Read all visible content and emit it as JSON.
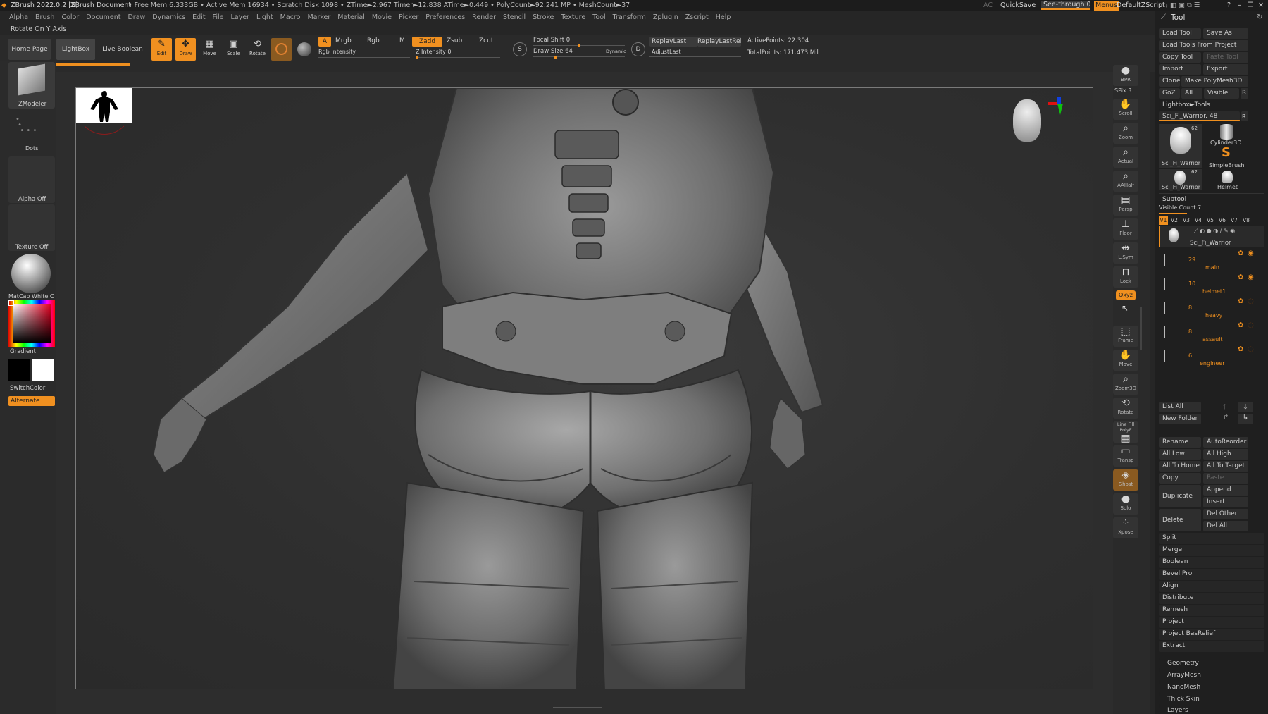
{
  "titlebar": {
    "app": "ZBrush 2022.0.2 [S]",
    "doc": "ZBrush Document",
    "stats": "• Free Mem 6.333GB • Active Mem 16934 • Scratch Disk 1098 • ZTime►2.967 Timer►12.838 ATime►0.449 • PolyCount►92.241 MP • MeshCount►37",
    "ac": "AC",
    "quicksave": "QuickSave",
    "seethrough": "See-through",
    "seethrough_value": "0",
    "menus": "Menus",
    "zscript": "DefaultZScript"
  },
  "menubar": [
    "Alpha",
    "Brush",
    "Color",
    "Document",
    "Draw",
    "Dynamics",
    "Edit",
    "File",
    "Layer",
    "Light",
    "Macro",
    "Marker",
    "Material",
    "Movie",
    "Picker",
    "Preferences",
    "Render",
    "Stencil",
    "Stroke",
    "Texture",
    "Tool",
    "Transform",
    "Zplugin",
    "Zscript",
    "Help"
  ],
  "status_hint": "Rotate On Y Axis",
  "shelf": {
    "home": "Home Page",
    "lightbox": "LightBox",
    "live_boolean": "Live Boolean",
    "edit": "Edit",
    "draw": "Draw",
    "move": "Move",
    "scale": "Scale",
    "rotate": "Rotate",
    "a": "A",
    "mrgb": "Mrgb",
    "rgb": "Rgb",
    "m": "M",
    "rgb_intensity": "Rgb Intensity",
    "zadd": "Zadd",
    "zsub": "Zsub",
    "zcut": "Zcut",
    "z_intensity": "Z Intensity",
    "z_intensity_value": "0",
    "focal_shift": "Focal Shift",
    "focal_shift_value": "0",
    "draw_size": "Draw Size",
    "draw_size_value": "64",
    "dynamic": "Dynamic",
    "replay_last": "ReplayLast",
    "replay_last_rel": "ReplayLastRel",
    "adjust_last": "AdjustLast",
    "active_points": "ActivePoints: 22.304",
    "total_points": "TotalPoints: 171.473 Mil"
  },
  "left": {
    "zmodeler": "ZModeler",
    "dots": "Dots",
    "alpha_off": "Alpha Off",
    "texture_off": "Texture Off",
    "matcap": "MatCap White C",
    "gradient": "Gradient",
    "switchcolor": "SwitchColor",
    "alternate": "Alternate"
  },
  "rightstrip": [
    "BPR",
    "SPix",
    "Scroll",
    "Zoom",
    "Actual",
    "AAHalf",
    "Persp",
    "Floor",
    "L.Sym",
    "Lock",
    "Qxyz",
    "",
    "Frame",
    "Move",
    "Zoom3D",
    "Rotate",
    "Line Fill PolyF",
    "Transp",
    "Ghost",
    "Solo",
    "Xpose"
  ],
  "rightstrip_spix_value": "3",
  "toolpanel": {
    "title": "Tool",
    "load_tool": "Load Tool",
    "save_as": "Save As",
    "load_from_project": "Load Tools From Project",
    "copy_tool": "Copy Tool",
    "paste_tool": "Paste Tool",
    "import": "Import",
    "export": "Export",
    "clone": "Clone",
    "make_polymesh": "Make PolyMesh3D",
    "goz": "GoZ",
    "all": "All",
    "visible": "Visible",
    "r": "R",
    "lightbox_tools": "Lightbox►Tools",
    "current_tool": "Sci_Fi_Warrior. 48",
    "thumbs": [
      {
        "name": "Sci_Fi_Warrior",
        "count": "62"
      },
      {
        "name": "Cylinder3D",
        "count": ""
      },
      {
        "name": "SimpleBrush",
        "count": ""
      },
      {
        "name": "Sci_Fi_Warrior",
        "count": "62"
      },
      {
        "name": "Helmet",
        "count": ""
      }
    ],
    "subtool": "Subtool",
    "visible_count": "Visible Count 7",
    "v_tabs": [
      "V1",
      "V2",
      "V3",
      "V4",
      "V5",
      "V6",
      "V7",
      "V8"
    ],
    "top_subtool": "Sci_Fi_Warrior",
    "folders": [
      {
        "count": "29",
        "name": "main"
      },
      {
        "count": "10",
        "name": "helmet1"
      },
      {
        "count": "8",
        "name": "heavy"
      },
      {
        "count": "8",
        "name": "assault"
      },
      {
        "count": "6",
        "name": "engineer"
      }
    ],
    "list_all": "List All",
    "new_folder": "New Folder",
    "rename": "Rename",
    "autoreorder": "AutoReorder",
    "all_low": "All Low",
    "all_high": "All High",
    "all_to_home": "All To Home",
    "all_to_target": "All To Target",
    "copy": "Copy",
    "paste": "Paste",
    "duplicate": "Duplicate",
    "append": "Append",
    "insert": "Insert",
    "delete": "Delete",
    "del_other": "Del Other",
    "del_all": "Del All",
    "sections": [
      "Split",
      "Merge",
      "Boolean",
      "Bevel Pro",
      "Align",
      "Distribute",
      "Remesh",
      "Project",
      "Project BasRelief",
      "Extract"
    ],
    "bottom_sections": [
      "Geometry",
      "ArrayMesh",
      "NanoMesh",
      "Thick Skin",
      "Layers"
    ]
  }
}
